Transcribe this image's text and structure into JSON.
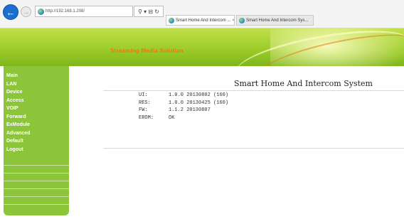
{
  "browser": {
    "url": "http://192.168.1.208/",
    "search_tools": "⚲ ▾ ⊟ ↻",
    "tabs": [
      {
        "label": "Smart Home And Intercom ...",
        "close": "×"
      },
      {
        "label": "Smart Home And Intercom Sys..."
      }
    ]
  },
  "banner": {
    "brand": "Streaming Media Solution"
  },
  "sidebar": {
    "items": [
      {
        "label": "Main"
      },
      {
        "label": "LAN"
      },
      {
        "label": "Device"
      },
      {
        "label": "Access"
      },
      {
        "label": "VOIP"
      },
      {
        "label": "Forward"
      },
      {
        "label": "ExModule"
      },
      {
        "label": "Advanced"
      },
      {
        "label": "Default"
      },
      {
        "label": "Logout"
      }
    ]
  },
  "main": {
    "title": "Smart Home And Intercom System",
    "info": [
      {
        "label": "UI:",
        "value": "1.0.0 20130802 (160)"
      },
      {
        "label": "RES:",
        "value": "1.0.0 20130425 (160)"
      },
      {
        "label": "FW:",
        "value": "1.1.2 20130807"
      },
      {
        "label": "EROM:",
        "value": "OK"
      }
    ]
  },
  "colors": {
    "accent_green": "#8cc43a",
    "brand_orange": "#e87a12",
    "browser_blue": "#1c6fd1"
  }
}
